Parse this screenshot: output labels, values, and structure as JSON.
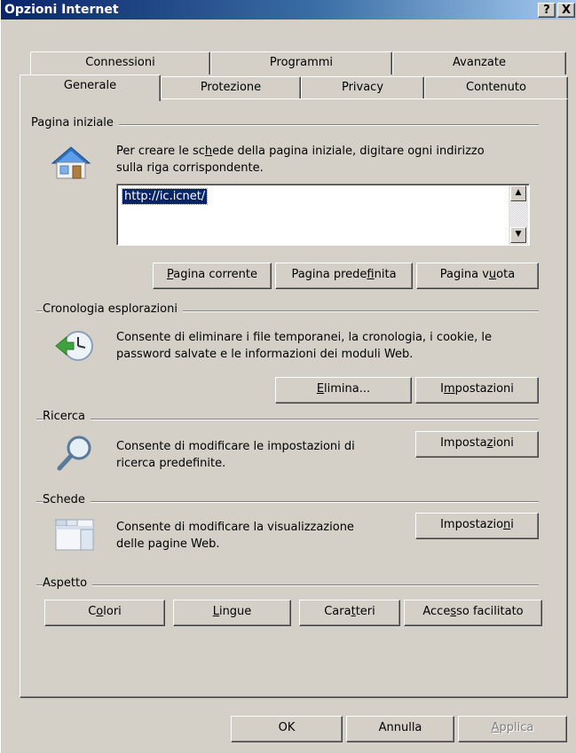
{
  "window": {
    "title": "Opzioni Internet",
    "help_btn": "?",
    "close_btn": "X"
  },
  "tabs_row1": [
    "Connessioni",
    "Programmi",
    "Avanzate"
  ],
  "tabs_row2": [
    "Generale",
    "Protezione",
    "Privacy",
    "Contenuto"
  ],
  "home": {
    "group_title": "Pagina iniziale",
    "desc_line1_pre": "Per creare le sc",
    "desc_line1_u": "h",
    "desc_line1_post": "ede della pagina iniziale, digitare ogni indirizzo",
    "desc_line2": "sulla riga corrispondente.",
    "url": "http://ic.icnet/",
    "btn_current_u": "P",
    "btn_current": "agina corrente",
    "btn_default_pre": "Pagina prede",
    "btn_default_u": "f",
    "btn_default_post": "inita",
    "btn_blank_pre": "Pagina v",
    "btn_blank_u": "u",
    "btn_blank_post": "ota"
  },
  "history": {
    "group_title": "Cronologia esplorazioni",
    "desc_line1": "Consente di eliminare i file temporanei, la cronologia, i cookie, le",
    "desc_line2": "password salvate e le informazioni dei moduli Web.",
    "btn_delete_u": "E",
    "btn_delete": "limina...",
    "btn_settings_pre": "I",
    "btn_settings_u": "m",
    "btn_settings_post": "postazioni"
  },
  "search": {
    "group_title": "Ricerca",
    "desc_line1": "Consente di modificare le impostazioni di",
    "desc_line2": "ricerca predefinite.",
    "btn_settings_pre": "Imposta",
    "btn_settings_u": "z",
    "btn_settings_post": "ioni"
  },
  "tabs_group": {
    "group_title": "Schede",
    "desc_line1": "Consente di modificare la visualizzazione",
    "desc_line2": "delle pagine Web.",
    "btn_settings_pre": "Impostazio",
    "btn_settings_u": "n",
    "btn_settings_post": "i"
  },
  "appearance": {
    "group_title": "Aspetto",
    "btn_colors_pre": "C",
    "btn_colors_u": "o",
    "btn_colors_post": "lori",
    "btn_lang_u": "L",
    "btn_lang": "ingue",
    "btn_fonts_pre": "Cara",
    "btn_fonts_u": "t",
    "btn_fonts_post": "teri",
    "btn_access_pre": "Acce",
    "btn_access_u": "s",
    "btn_access_post": "so facilitato"
  },
  "footer": {
    "ok": "OK",
    "cancel": "Annulla",
    "apply_u": "A",
    "apply": "pplica"
  },
  "colors": {
    "titlebar_start": "#0a246a",
    "titlebar_end": "#a6caf0",
    "face": "#d4d0c8",
    "selection": "#0a246a"
  }
}
